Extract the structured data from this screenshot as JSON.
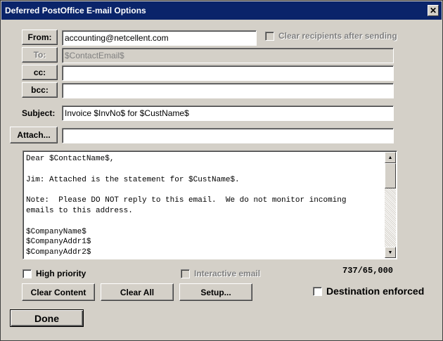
{
  "window": {
    "title": "Deferred PostOffice E-mail Options",
    "close_glyph": "✕"
  },
  "from": {
    "button_label": "From:",
    "value": "accounting@netcellent.com"
  },
  "clear_recipients": {
    "label": "Clear recipients after sending",
    "checked": false,
    "enabled": false
  },
  "to": {
    "button_label": "To:",
    "value": "$ContactEmail$"
  },
  "cc": {
    "button_label": "cc:",
    "value": ""
  },
  "bcc": {
    "button_label": "bcc:",
    "value": ""
  },
  "subject": {
    "label": "Subject:",
    "value": "Invoice $InvNo$ for $CustName$"
  },
  "attach": {
    "button_label": "Attach...",
    "value": ""
  },
  "body": {
    "lines": [
      "Dear $ContactName$,",
      "",
      "Jim: Attached is the statement for $CustName$.",
      "",
      "Note:  Please DO NOT reply to this email.  We do not monitor incoming",
      "emails to this address.",
      "",
      "$CompanyName$",
      "$CompanyAddr1$",
      "$CompanyAddr2$"
    ]
  },
  "options": {
    "high_priority": {
      "label": "High priority",
      "checked": false
    },
    "interactive_email": {
      "label": "Interactive email",
      "checked": false,
      "enabled": false
    },
    "destination_enforced": {
      "label": "Destination enforced",
      "checked": false
    }
  },
  "counter": "737/65,000",
  "buttons": {
    "clear_content": "Clear Content",
    "clear_all": "Clear All",
    "setup": "Setup...",
    "done": "Done"
  },
  "scrollbar": {
    "up_glyph": "▲",
    "down_glyph": "▼"
  }
}
